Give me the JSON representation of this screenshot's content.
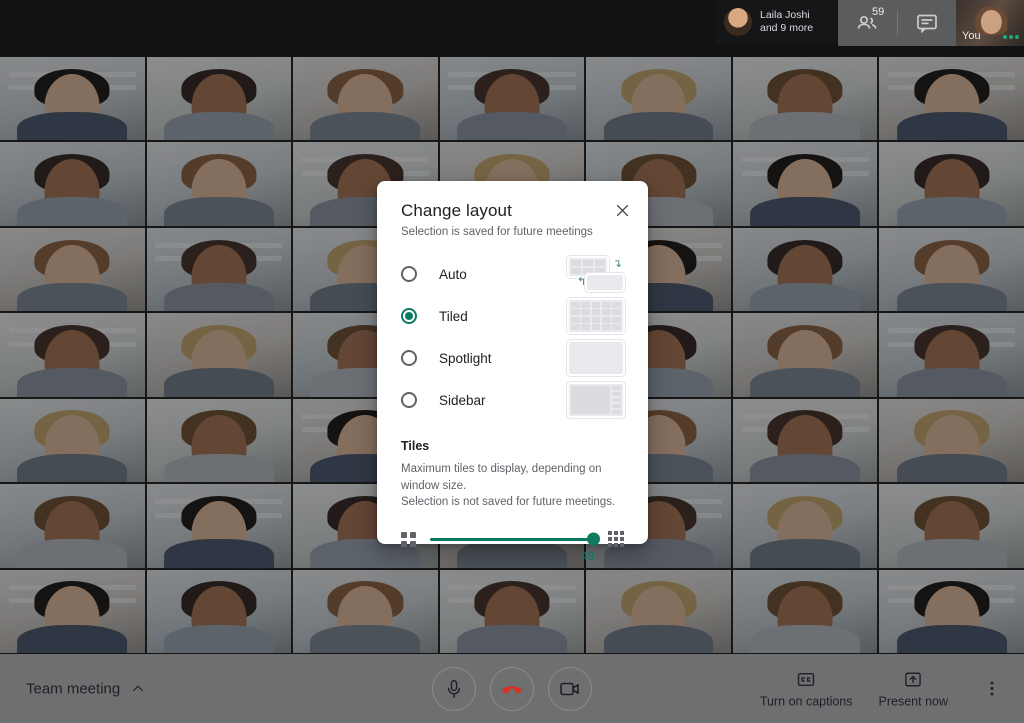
{
  "top_bar": {
    "active_speaker": {
      "name": "Laila Joshi",
      "others": "and 9 more",
      "avatar_icon": "avatar"
    },
    "participants": {
      "icon": "people-icon",
      "count": "59"
    },
    "chat": {
      "icon": "chat-icon"
    },
    "self_view": {
      "label": "You",
      "menu_icon": "more-dots-icon"
    }
  },
  "dialog": {
    "title": "Change layout",
    "subtitle": "Selection is saved for future meetings",
    "close_icon": "close-icon",
    "options": [
      {
        "id": "auto",
        "label": "Auto",
        "selected": false,
        "thumbnail": "auto-layout-thumbnail"
      },
      {
        "id": "tiled",
        "label": "Tiled",
        "selected": true,
        "thumbnail": "tiled-layout-thumbnail"
      },
      {
        "id": "spotlight",
        "label": "Spotlight",
        "selected": false,
        "thumbnail": "spotlight-layout-thumbnail"
      },
      {
        "id": "sidebar",
        "label": "Sidebar",
        "selected": false,
        "thumbnail": "sidebar-layout-thumbnail"
      }
    ],
    "tiles": {
      "heading": "Tiles",
      "description_line1": "Maximum tiles to display, depending on window size.",
      "description_line2": "Selection is not saved for future meetings.",
      "min_icon": "grid-small-icon",
      "max_icon": "grid-large-icon",
      "value": "49"
    }
  },
  "bottom_bar": {
    "meeting_name": "Team meeting",
    "meeting_name_chevron": "chevron-up-icon",
    "controls": [
      {
        "id": "microphone",
        "icon": "microphone-icon"
      },
      {
        "id": "hang-up",
        "icon": "phone-hangup-icon"
      },
      {
        "id": "camera",
        "icon": "video-camera-icon"
      }
    ],
    "captions": {
      "label": "Turn on captions",
      "icon": "closed-captions-icon"
    },
    "present": {
      "label": "Present now",
      "icon": "present-screen-icon"
    },
    "more": {
      "icon": "more-vertical-icon"
    }
  },
  "colors": {
    "accent_green": "#0b7a61",
    "hangup_red": "#d93025",
    "bottom_bar": "#6e6f71",
    "dialog_bg": "#ffffff"
  }
}
